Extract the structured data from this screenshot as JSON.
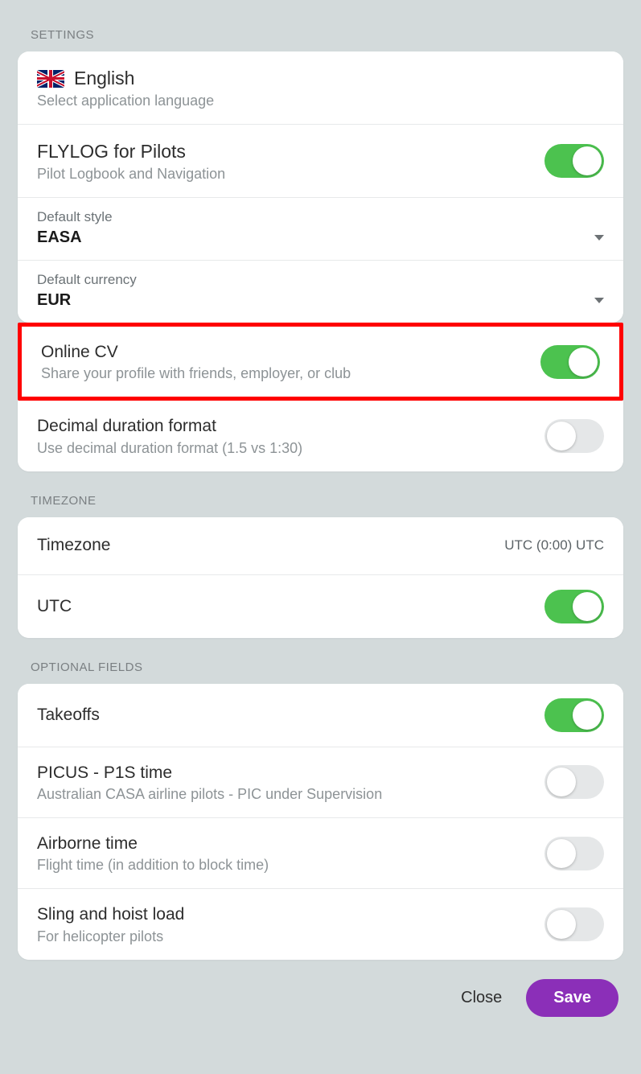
{
  "sections": {
    "settings_header": "SETTINGS",
    "timezone_header": "TIMEZONE",
    "optional_header": "OPTIONAL FIELDS"
  },
  "language": {
    "title": "English",
    "sub": "Select application language"
  },
  "flylog": {
    "title": "FLYLOG for Pilots",
    "sub": "Pilot Logbook and Navigation",
    "on": true
  },
  "default_style": {
    "label": "Default style",
    "value": "EASA"
  },
  "default_currency": {
    "label": "Default currency",
    "value": "EUR"
  },
  "online_cv": {
    "title": "Online CV",
    "sub": "Share your profile with friends, employer, or club",
    "on": true
  },
  "decimal": {
    "title": "Decimal duration format",
    "sub": "Use decimal duration format (1.5 vs 1:30)",
    "on": false
  },
  "timezone": {
    "title": "Timezone",
    "value": "UTC (0:00) UTC"
  },
  "utc": {
    "title": "UTC",
    "on": true
  },
  "takeoffs": {
    "title": "Takeoffs",
    "on": true
  },
  "picus": {
    "title": "PICUS - P1S time",
    "sub": "Australian CASA airline pilots - PIC under Supervision",
    "on": false
  },
  "airborne": {
    "title": "Airborne time",
    "sub": "Flight time (in addition to block time)",
    "on": false
  },
  "sling": {
    "title": "Sling and hoist load",
    "sub": "For helicopter pilots",
    "on": false
  },
  "footer": {
    "close": "Close",
    "save": "Save"
  }
}
